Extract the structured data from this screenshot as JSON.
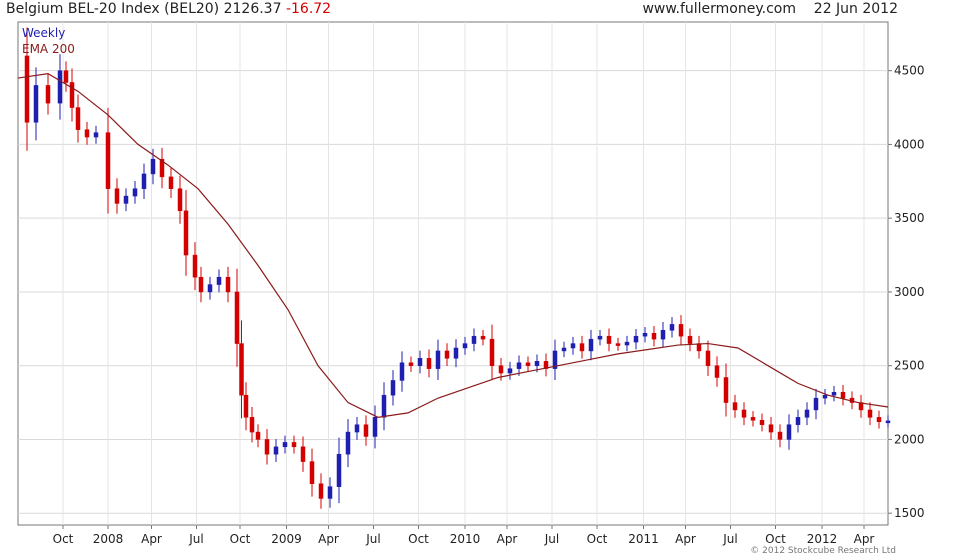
{
  "header": {
    "title": "Belgium BEL-20 Index (BEL20) 2126.37",
    "change": "-16.72",
    "site": "www.fullermoney.com",
    "date": "22 Jun 2012"
  },
  "copyright": "© 2012 Stockcube Research Ltd",
  "chart_data": {
    "type": "candlestick",
    "title": "Belgium BEL-20 Index (BEL20) 2126.37 -16.72",
    "legend": [
      {
        "name": "Weekly",
        "color": "#1f1fb0"
      },
      {
        "name": "EMA 200",
        "color": "#8b1a1a"
      }
    ],
    "legend_placement": "top-left",
    "grid": true,
    "y_axis": {
      "ylim": [
        1420,
        4830
      ],
      "ticks": [
        1500,
        2000,
        2500,
        3000,
        3500,
        4000,
        4500
      ],
      "side": "right"
    },
    "x_axis": {
      "xlim": [
        0,
        58
      ],
      "ticks": [
        {
          "x": 3.0,
          "label": "Oct"
        },
        {
          "x": 6.0,
          "label": "2008"
        },
        {
          "x": 8.9,
          "label": "Apr"
        },
        {
          "x": 11.9,
          "label": "Jul"
        },
        {
          "x": 14.8,
          "label": "Oct"
        },
        {
          "x": 17.9,
          "label": "2009"
        },
        {
          "x": 20.7,
          "label": "Apr"
        },
        {
          "x": 23.7,
          "label": "Jul"
        },
        {
          "x": 26.7,
          "label": "Oct"
        },
        {
          "x": 29.8,
          "label": "2010"
        },
        {
          "x": 32.6,
          "label": "Apr"
        },
        {
          "x": 35.6,
          "label": "Jul"
        },
        {
          "x": 38.6,
          "label": "Oct"
        },
        {
          "x": 41.7,
          "label": "2011"
        },
        {
          "x": 44.5,
          "label": "Apr"
        },
        {
          "x": 47.5,
          "label": "Jul"
        },
        {
          "x": 50.5,
          "label": "Oct"
        },
        {
          "x": 53.6,
          "label": "2012"
        },
        {
          "x": 56.4,
          "label": "Apr"
        }
      ]
    },
    "price_series": {
      "name": "Weekly",
      "x": [
        0,
        0.6,
        1.2,
        2.0,
        2.8,
        3.2,
        3.6,
        4.0,
        4.6,
        5.2,
        6.0,
        6.6,
        7.2,
        7.8,
        8.4,
        9.0,
        9.6,
        10.2,
        10.8,
        11.2,
        11.8,
        12.2,
        12.8,
        13.4,
        14.0,
        14.6,
        14.9,
        15.2,
        15.6,
        16.0,
        16.6,
        17.2,
        17.8,
        18.4,
        19.0,
        19.6,
        20.2,
        20.8,
        21.4,
        22.0,
        22.6,
        23.2,
        23.8,
        24.4,
        25.0,
        25.6,
        26.2,
        26.8,
        27.4,
        28.0,
        28.6,
        29.2,
        29.8,
        30.4,
        31.0,
        31.6,
        32.2,
        32.8,
        33.4,
        34.0,
        34.6,
        35.2,
        35.8,
        36.4,
        37.0,
        37.6,
        38.2,
        38.8,
        39.4,
        40.0,
        40.6,
        41.2,
        41.8,
        42.4,
        43.0,
        43.6,
        44.2,
        44.8,
        45.4,
        46.0,
        46.6,
        47.2,
        47.8,
        48.4,
        49.0,
        49.6,
        50.2,
        50.8,
        51.4,
        52.0,
        52.6,
        53.2,
        53.8,
        54.4,
        55.0,
        55.6,
        56.2,
        56.8,
        57.4,
        58.0
      ],
      "y": [
        4600,
        4150,
        4400,
        4280,
        4500,
        4420,
        4250,
        4100,
        4050,
        4080,
        3700,
        3600,
        3650,
        3700,
        3800,
        3900,
        3780,
        3700,
        3550,
        3250,
        3100,
        3000,
        3050,
        3100,
        3000,
        2650,
        2300,
        2150,
        2050,
        2000,
        1900,
        1950,
        1980,
        1950,
        1850,
        1700,
        1600,
        1680,
        1900,
        2050,
        2100,
        2020,
        2150,
        2300,
        2400,
        2520,
        2500,
        2550,
        2480,
        2600,
        2550,
        2620,
        2650,
        2700,
        2680,
        2500,
        2450,
        2480,
        2520,
        2500,
        2530,
        2480,
        2600,
        2620,
        2650,
        2600,
        2680,
        2700,
        2650,
        2640,
        2660,
        2700,
        2720,
        2680,
        2740,
        2780,
        2700,
        2650,
        2600,
        2500,
        2420,
        2250,
        2200,
        2150,
        2130,
        2100,
        2050,
        2000,
        2100,
        2150,
        2200,
        2280,
        2300,
        2320,
        2280,
        2250,
        2200,
        2150,
        2120,
        2126
      ]
    },
    "ema_series": {
      "name": "EMA 200",
      "x": [
        0,
        2,
        4,
        6,
        8,
        10,
        12,
        14,
        16,
        18,
        20,
        22,
        24,
        26,
        28,
        30,
        32,
        34,
        36,
        38,
        40,
        42,
        44,
        46,
        48,
        50,
        52,
        54,
        56,
        58
      ],
      "y": [
        4450,
        4480,
        4360,
        4200,
        4000,
        3860,
        3700,
        3460,
        3180,
        2880,
        2500,
        2250,
        2150,
        2180,
        2280,
        2350,
        2420,
        2460,
        2500,
        2540,
        2580,
        2610,
        2640,
        2650,
        2620,
        2500,
        2380,
        2300,
        2250,
        2220
      ]
    }
  }
}
